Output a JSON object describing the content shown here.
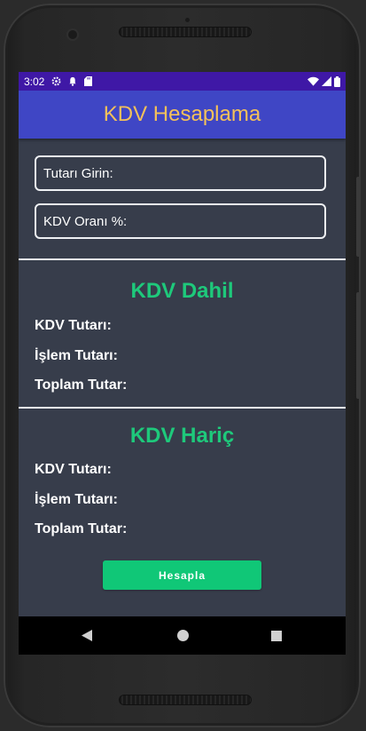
{
  "status_bar": {
    "time": "3:02",
    "left_icons": [
      "gear-icon",
      "notification-bell-icon",
      "sd-card-icon"
    ],
    "right_icons": [
      "wifi-icon",
      "cell-signal-icon",
      "battery-icon"
    ],
    "color": "#3f18a6"
  },
  "app_bar": {
    "title": "KDV Hesaplama",
    "background": "#3f46c5",
    "title_color": "#f4c15a"
  },
  "inputs": {
    "amount_placeholder": "Tutarı Girin:",
    "rate_placeholder": "KDV Oranı %:"
  },
  "included_section": {
    "title": "KDV Dahil",
    "vat_amount_label": "KDV Tutarı:",
    "net_amount_label": "İşlem Tutarı:",
    "total_label": "Toplam Tutar:"
  },
  "excluded_section": {
    "title": "KDV Hariç",
    "vat_amount_label": "KDV Tutarı:",
    "net_amount_label": "İşlem Tutarı:",
    "total_label": "Toplam Tutar:"
  },
  "calculate_button": {
    "label": "Hesapla",
    "color": "#10c777"
  },
  "nav_bar": {
    "icons": [
      "back-icon",
      "home-icon",
      "recents-icon"
    ]
  },
  "colors": {
    "screen_background": "#373d4b",
    "section_title": "#1ec97b"
  }
}
